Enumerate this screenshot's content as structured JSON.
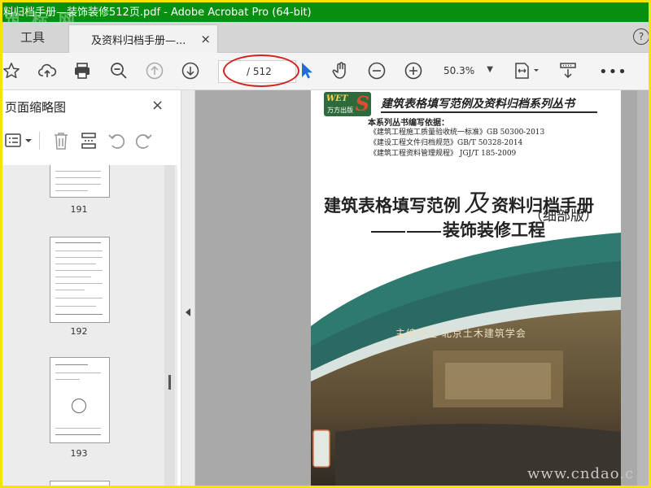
{
  "window": {
    "title": "料归档手册—装饰装修512页.pdf - Adobe Acrobat Pro (64-bit)",
    "watermark": "筑 标 网"
  },
  "tabs": {
    "tools_label": "工具",
    "doc_label": "及资料归档手册—...",
    "close_glyph": "×",
    "help_glyph": "?"
  },
  "toolbar": {
    "page_current": "",
    "page_total": "/ 512",
    "zoom": "50.3%",
    "icons": [
      "star-icon",
      "cloud-upload-icon",
      "print-icon",
      "zoom-out-magnifier-icon",
      "page-up-icon",
      "page-down-icon",
      "select-cursor-icon",
      "hand-icon",
      "zoom-minus-icon",
      "zoom-plus-icon",
      "fit-page-icon",
      "scroll-mode-icon",
      "more-icon"
    ],
    "accent_color": "#1f6fd6",
    "highlight_color": "#d42020"
  },
  "sidebar": {
    "title": "页面缩略图",
    "close_glyph": "×",
    "thumbnails": [
      {
        "label": "191"
      },
      {
        "label": "192"
      },
      {
        "label": "193"
      }
    ]
  },
  "document": {
    "logo_text": "WET",
    "logo_letter": "S",
    "logo_sub": "万方出版",
    "series_title": "建筑表格填写范例及资料归档系列丛书",
    "basis_label": "本系列丛书编写依据：",
    "basis": [
      "《建筑工程施工质量验收统一标准》GB 50300-2013",
      "《建设工程文件归档规范》GB/T 50328-2014",
      "《建筑工程资料管理规程》 JGJ/T 185-2009"
    ],
    "title_part1": "建筑表格填写范例",
    "title_ji": "及",
    "title_part2": "资料归档手册",
    "subtitle": "（细部版）",
    "subject": "装饰装修工程",
    "editor": "主编单位   北京土木建筑学会"
  },
  "watermark_bottom": "www.cndao.c"
}
